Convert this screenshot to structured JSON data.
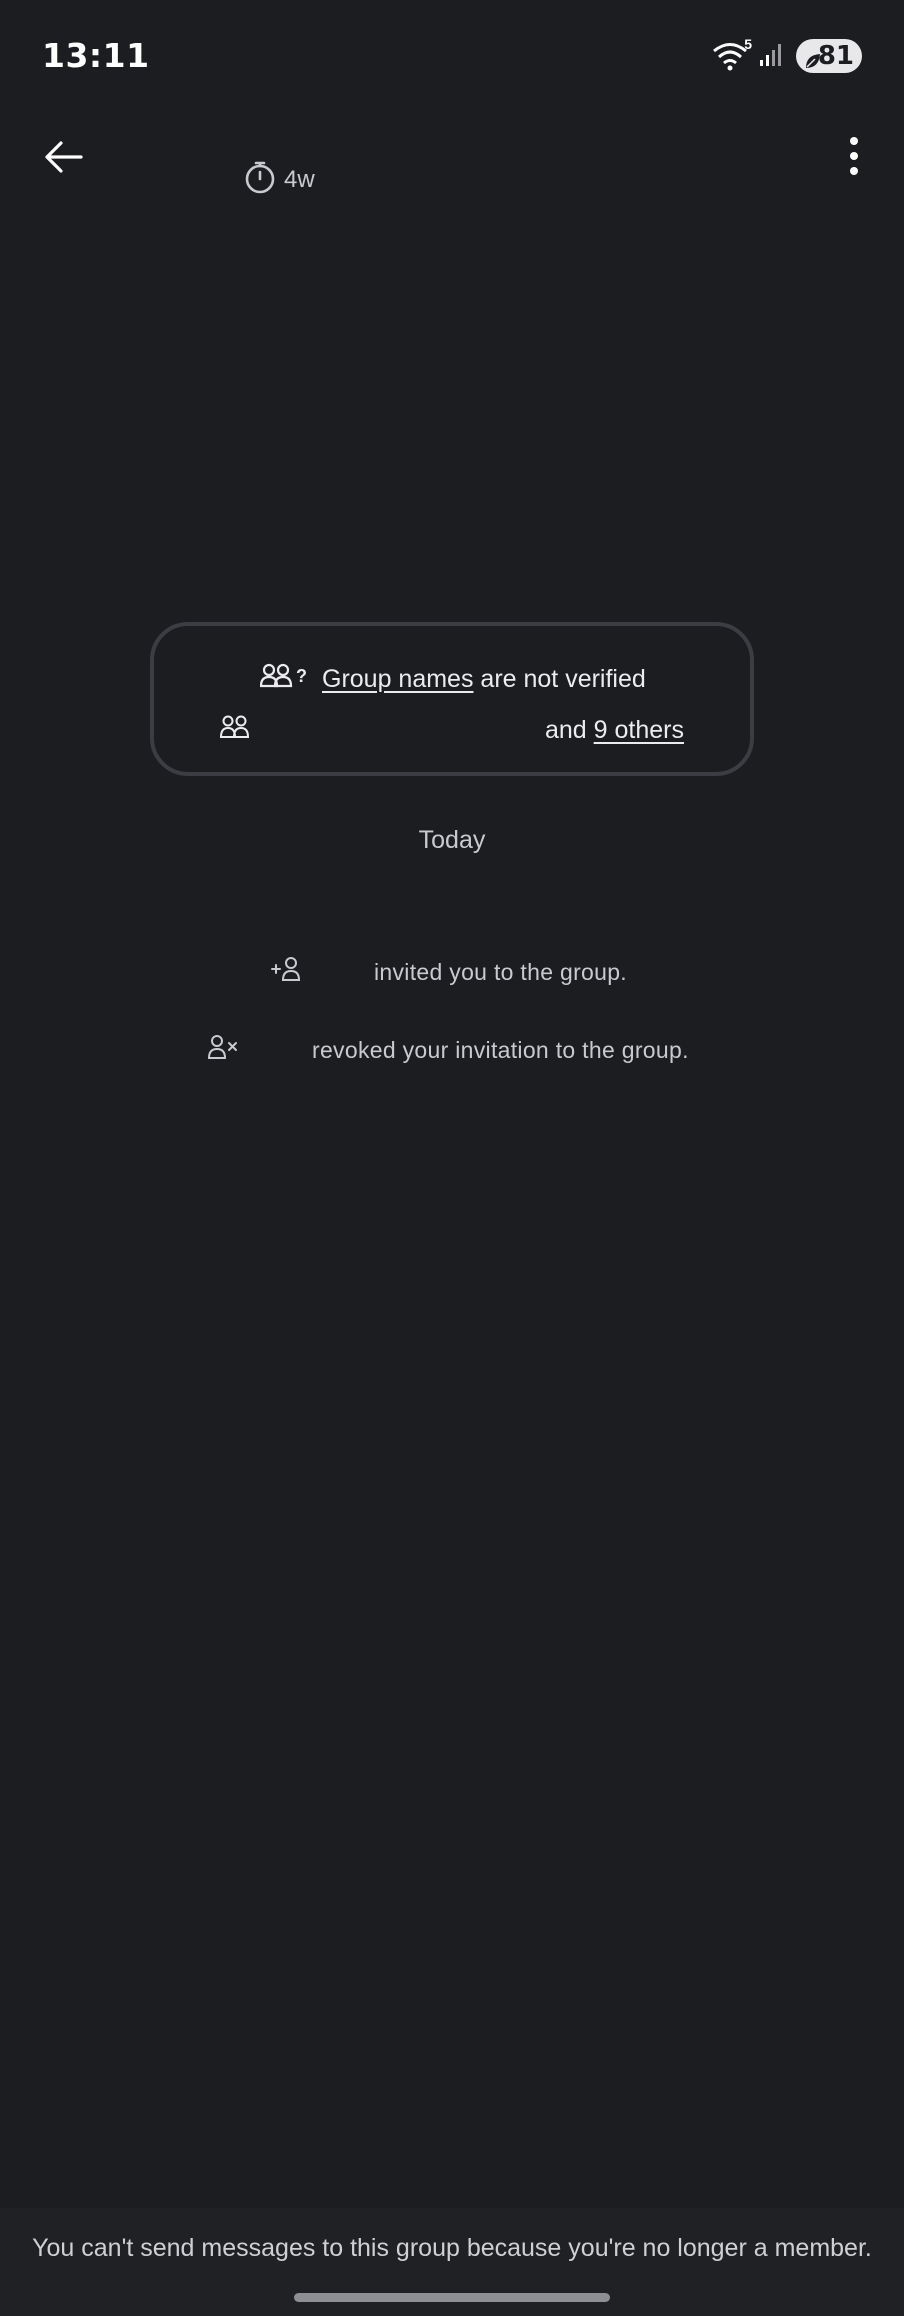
{
  "status_bar": {
    "time": "13:11",
    "network_badge": "5",
    "battery_level": "81",
    "icons": [
      "wifi-icon",
      "signal-icon",
      "battery-saver-leaf-icon"
    ]
  },
  "app_bar": {
    "back_icon": "arrow-left-icon",
    "timer_icon": "stopwatch-icon",
    "timer_label": "4w",
    "more_icon": "more-vertical-icon"
  },
  "group_card": {
    "row1_icon": "group-question-icon",
    "row1_link": "Group names",
    "row1_text": " are not verified",
    "row2_icon": "group-members-icon",
    "row2_prefix": "and ",
    "row2_link": "9 others"
  },
  "timeline": {
    "day_label": "Today",
    "events": [
      {
        "icon": "person-add-icon",
        "text": "invited you to the group."
      },
      {
        "icon": "person-remove-icon",
        "text": "revoked your invitation to the group."
      }
    ]
  },
  "footer": {
    "message": "You can't send messages to this group because you're no longer a member."
  },
  "colors": {
    "background": "#1c1d21",
    "card_border": "#3c3d42",
    "text_primary": "#ececee",
    "text_secondary": "#c9cacf"
  }
}
